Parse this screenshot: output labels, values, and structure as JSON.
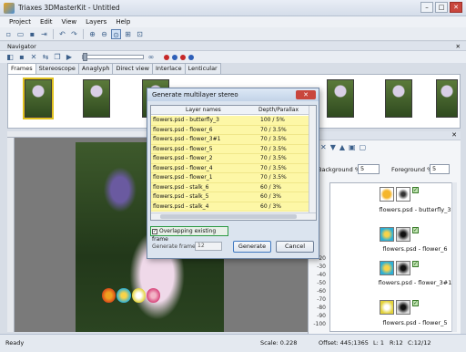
{
  "window": {
    "title": "Triaxes 3DMasterKit - Untitled"
  },
  "menu": [
    "Project",
    "Edit",
    "View",
    "Layers",
    "Help"
  ],
  "navigator": {
    "title": "Navigator",
    "tabs": [
      "Frames",
      "Stereoscope",
      "Anaglyph",
      "Direct view",
      "Interlace",
      "Lenticular"
    ],
    "active_tab": "Frames",
    "dot_colors": [
      "#c62828",
      "#2e5fb8",
      "#c62828",
      "#2e5fb8"
    ]
  },
  "dialog": {
    "title": "Generate multilayer stereo",
    "columns": {
      "layer": "Layer names",
      "depth": "Depth/Parallax"
    },
    "rows": [
      {
        "name": "flowers.psd - butterfly_3",
        "depth": "100 / 5%"
      },
      {
        "name": "flowers.psd - flower_6",
        "depth": "70 / 3.5%"
      },
      {
        "name": "flowers.psd - flower_3#1",
        "depth": "70 / 3.5%"
      },
      {
        "name": "flowers.psd - flower_5",
        "depth": "70 / 3.5%"
      },
      {
        "name": "flowers.psd - flower_2",
        "depth": "70 / 3.5%"
      },
      {
        "name": "flowers.psd - flower_4",
        "depth": "70 / 3.5%"
      },
      {
        "name": "flowers.psd - flower_1",
        "depth": "70 / 3.5%"
      },
      {
        "name": "flowers.psd - stalk_6",
        "depth": "60 / 3%"
      },
      {
        "name": "flowers.psd - stalk_5",
        "depth": "60 / 3%"
      },
      {
        "name": "flowers.psd - stalk_4",
        "depth": "60 / 3%"
      }
    ],
    "overlap_label": "Overlapping existing frame",
    "overlap_checked": true,
    "generate_frames_label": "Generate frames:",
    "generate_frames_value": "12",
    "generate_button": "Generate",
    "cancel_button": "Cancel"
  },
  "right_panel": {
    "background_label": "Background %",
    "background_value": "5",
    "foreground_label": "Foreground %",
    "foreground_value": "5",
    "ruler_ticks": [
      "-20",
      "-30",
      "-40",
      "-50",
      "-60",
      "-70",
      "-80",
      "-90",
      "-100"
    ],
    "layers": [
      {
        "label": "flowers.psd - butterfly_3"
      },
      {
        "label": "flowers.psd - flower_6"
      },
      {
        "label": "flowers.psd - flower_3#1"
      },
      {
        "label": "flowers.psd - flower_5"
      }
    ]
  },
  "status": {
    "state": "Ready",
    "scale": "Scale: 0.228",
    "offset": "Offset: 445;1365",
    "l": "L: 1",
    "r": "R:12",
    "c": "C:12/12"
  }
}
